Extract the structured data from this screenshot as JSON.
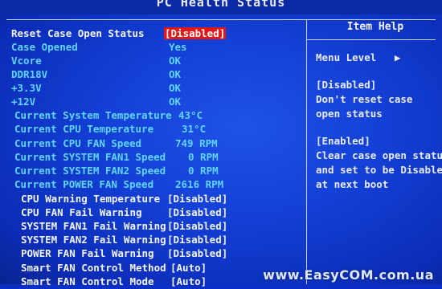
{
  "window": {
    "title": "PC Health Status"
  },
  "main": {
    "rows": [
      {
        "label": "Reset Case Open Status",
        "value": "[Disabled]",
        "label_color": "white",
        "value_color": "selected"
      },
      {
        "label": "Case Opened",
        "value": "Yes",
        "label_color": "cyan",
        "value_color": "cyan"
      },
      {
        "label": "Vcore",
        "value": "OK",
        "label_color": "cyan",
        "value_color": "cyan"
      },
      {
        "label": "DDR18V",
        "value": "OK",
        "label_color": "cyan",
        "value_color": "cyan"
      },
      {
        "label": "+3.3V",
        "value": "OK",
        "label_color": "cyan",
        "value_color": "cyan"
      },
      {
        "label": "+12V",
        "value": "OK",
        "label_color": "cyan",
        "value_color": "cyan"
      },
      {
        "label": "Current System Temperature",
        "value": "43°C",
        "label_color": "cyan",
        "value_color": "cyan"
      },
      {
        "label": "Current CPU Temperature",
        "value": "31°C",
        "label_color": "cyan",
        "value_color": "cyan"
      },
      {
        "label": "Current CPU FAN Speed",
        "value": "749 RPM",
        "label_color": "cyan",
        "value_color": "cyan"
      },
      {
        "label": "Current SYSTEM FAN1 Speed",
        "value": "0 RPM",
        "label_color": "cyan",
        "value_color": "cyan"
      },
      {
        "label": "Current SYSTEM FAN2 Speed",
        "value": "0 RPM",
        "label_color": "cyan",
        "value_color": "cyan"
      },
      {
        "label": "Current POWER FAN Speed",
        "value": "2616 RPM",
        "label_color": "cyan",
        "value_color": "cyan"
      },
      {
        "label": "CPU Warning Temperature",
        "value": "[Disabled]",
        "label_color": "white",
        "value_color": "white"
      },
      {
        "label": "CPU FAN Fail Warning",
        "value": "[Disabled]",
        "label_color": "white",
        "value_color": "white"
      },
      {
        "label": "SYSTEM FAN1 Fail Warning",
        "value": "[Disabled]",
        "label_color": "white",
        "value_color": "white"
      },
      {
        "label": "SYSTEM FAN2 Fail Warning",
        "value": "[Disabled]",
        "label_color": "white",
        "value_color": "white"
      },
      {
        "label": "POWER FAN Fail Warning",
        "value": "[Disabled]",
        "label_color": "white",
        "value_color": "white"
      },
      {
        "label": "Smart FAN Control Method",
        "value": "[Auto]",
        "label_color": "white",
        "value_color": "white"
      },
      {
        "label": "Smart FAN Control Mode",
        "value": "[Auto]",
        "label_color": "white",
        "value_color": "white"
      }
    ]
  },
  "help": {
    "title": "Item Help",
    "menu_level": "Menu Level",
    "menu_level_icon": "right-arrow-icon",
    "lines": [
      "[Disabled]",
      "Don't reset case",
      "open status",
      "",
      "[Enabled]",
      "Clear case open status",
      "and set to be Disabled",
      "at next boot"
    ]
  },
  "watermark": "www.EasyCOM.com.ua",
  "colors": {
    "background": "#1440d6",
    "cyan": "#5fd6ff",
    "white": "#f2f5ff",
    "selected": "#e01818"
  }
}
